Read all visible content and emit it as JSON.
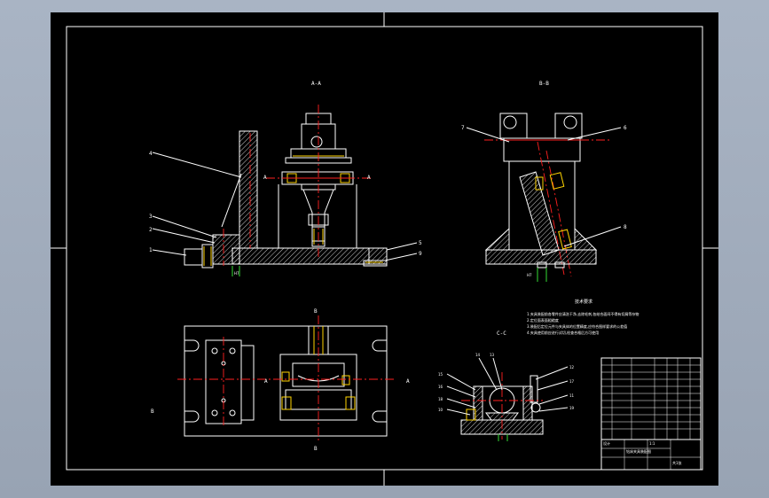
{
  "views": {
    "front_section": "A-A",
    "side_section": "B-B",
    "detail_section": "C-C",
    "top_view_mark": "B",
    "section_mark_left": "A",
    "section_mark_right": "A",
    "cut_mark_bottom": "B"
  },
  "balloons": {
    "front": [
      "1",
      "2",
      "3",
      "4",
      "5",
      "9"
    ],
    "side": [
      "7",
      "6",
      "8"
    ],
    "detail": [
      "15",
      "16",
      "14",
      "13",
      "12",
      "10",
      "11",
      "17",
      "18",
      "19"
    ]
  },
  "tech_requirements": {
    "title": "技术要求",
    "lines": [
      "1.夹具装配前各零件应清洗干净,去除毛刺,各结合面间不得有切屑等杂物",
      "2.定位面表面粗糙度",
      "3.装配后定位元件与夹具体的位置精度,应符合图样要求的公差值",
      "4.夹具使用前应进行试切,检查合格后方可使用"
    ]
  },
  "title_block": {
    "drawing_name": "钻床夹具装配图",
    "scale": "1:1",
    "sheet": "共1张",
    "school": "设计"
  },
  "colors": {
    "background": "#000000",
    "frame": "#ffffff",
    "centerline": "#ff2020",
    "highlight": "#ffd400",
    "dimension": "#33dd33"
  }
}
